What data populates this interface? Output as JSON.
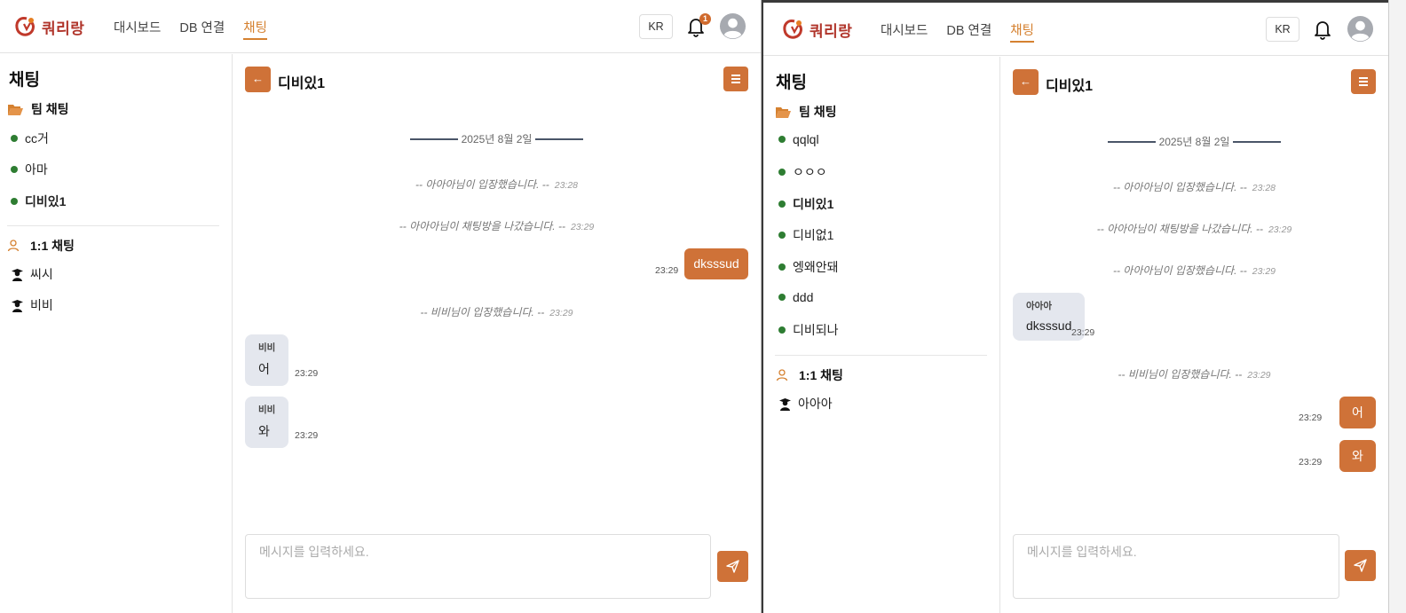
{
  "colors": {
    "accent": "#cf7238",
    "nav_active": "#d58130",
    "online": "#2e7d32",
    "brand": "#b0342a"
  },
  "left": {
    "logo_text": "쿼리랑",
    "nav": [
      "대시보드",
      "DB 연결",
      "채팅"
    ],
    "active_nav": "채팅",
    "lang": "KR",
    "notification_count": "1",
    "sidebar": {
      "title": "채팅",
      "team_section": "팀 채팅",
      "rooms": [
        "cc거",
        "아마",
        "디비있1"
      ],
      "active_room": "디비있1",
      "dm_section": "1:1 채팅",
      "dms": [
        "씨시",
        "비비"
      ]
    },
    "chat": {
      "room": "디비있1",
      "date": "2025년 8월 2일",
      "sys1": {
        "text": "-- 아아아님이 입장했습니다. --",
        "time": "23:28"
      },
      "sys2": {
        "text": "-- 아아아님이 채팅방을 나갔습니다. --",
        "time": "23:29"
      },
      "sent1": {
        "text": "dksssud",
        "time": "23:29"
      },
      "sys3": {
        "text": "-- 비비님이 입장했습니다. --",
        "time": "23:29"
      },
      "recv1": {
        "sender": "비비",
        "text": "어",
        "time": "23:29"
      },
      "recv2": {
        "sender": "비비",
        "text": "와",
        "time": "23:29"
      },
      "placeholder": "메시지를 입력하세요."
    }
  },
  "right": {
    "logo_text": "쿼리랑",
    "nav": [
      "대시보드",
      "DB 연결",
      "채팅"
    ],
    "active_nav": "채팅",
    "lang": "KR",
    "sidebar": {
      "title": "채팅",
      "team_section": "팀 채팅",
      "rooms": [
        "qqlql",
        "ㅇㅇㅇ",
        "디비있1",
        "디비없1",
        "엥왜안돼",
        "ddd",
        "디비되나"
      ],
      "active_room": "디비있1",
      "dm_section": "1:1 채팅",
      "dms": [
        "아아아"
      ]
    },
    "chat": {
      "room": "디비있1",
      "date": "2025년 8월 2일",
      "sys1": {
        "text": "-- 아아아님이 입장했습니다. --",
        "time": "23:28"
      },
      "sys2": {
        "text": "-- 아아아님이 채팅방을 나갔습니다. --",
        "time": "23:29"
      },
      "sys3": {
        "text": "-- 아아아님이 입장했습니다. --",
        "time": "23:29"
      },
      "recv1": {
        "sender": "아아아",
        "text": "dksssud",
        "time": "23:29"
      },
      "sys4": {
        "text": "-- 비비님이 입장했습니다. --",
        "time": "23:29"
      },
      "sent1": {
        "text": "어",
        "time": "23:29"
      },
      "sent2": {
        "text": "와",
        "time": "23:29"
      },
      "placeholder": "메시지를 입력하세요."
    }
  }
}
